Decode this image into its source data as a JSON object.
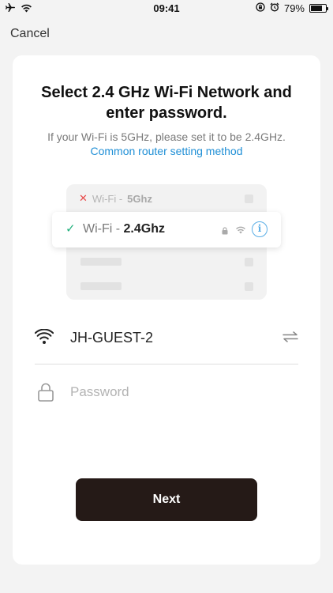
{
  "status_bar": {
    "time": "09:41",
    "battery": "79%",
    "battery_level": 0.79,
    "icons": [
      "airplane-icon",
      "wifi-icon",
      "orientation-lock-icon",
      "alarm-icon",
      "battery-icon"
    ]
  },
  "nav": {
    "cancel_label": "Cancel"
  },
  "card": {
    "title": "Select 2.4 GHz Wi-Fi Network and enter password.",
    "hint": "If your Wi-Fi is 5GHz, please set it to be 2.4GHz.",
    "link": "Common router setting method"
  },
  "illustration": {
    "row_5g_prefix": "Wi-Fi - ",
    "row_5g_band": "5Ghz",
    "row_24g_prefix": "Wi-Fi - ",
    "row_24g_band": "2.4Ghz",
    "info_glyph": "i"
  },
  "form": {
    "network_name": "JH-GUEST-2",
    "password_placeholder": "Password",
    "password_value": ""
  },
  "actions": {
    "next_label": "Next"
  },
  "colors": {
    "link": "#1f8fd6",
    "next_button": "#251a17",
    "check": "#22b07d",
    "cross": "#e84a4a"
  }
}
